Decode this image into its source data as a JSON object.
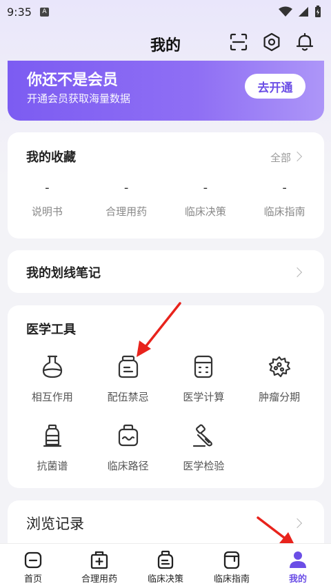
{
  "status": {
    "time": "9:35",
    "notif": "A"
  },
  "header": {
    "title": "我的"
  },
  "vip": {
    "title": "你还不是会员",
    "subtitle": "开通会员获取海量数据",
    "button": "去开通"
  },
  "favorites": {
    "title": "我的收藏",
    "all_label": "全部",
    "items": [
      {
        "label": "说明书",
        "count": "-"
      },
      {
        "label": "合理用药",
        "count": "-"
      },
      {
        "label": "临床决策",
        "count": "-"
      },
      {
        "label": "临床指南",
        "count": "-"
      }
    ]
  },
  "notes": {
    "title": "我的划线笔记"
  },
  "tools": {
    "title": "医学工具",
    "items": [
      {
        "label": "相互作用",
        "icon": "flask-icon"
      },
      {
        "label": "配伍禁忌",
        "icon": "jar-icon"
      },
      {
        "label": "医学计算",
        "icon": "calculator-icon"
      },
      {
        "label": "肿瘤分期",
        "icon": "virus-icon"
      },
      {
        "label": "抗菌谱",
        "icon": "bottle-icon"
      },
      {
        "label": "临床路径",
        "icon": "path-box-icon"
      },
      {
        "label": "医学检验",
        "icon": "test-tube-icon"
      }
    ]
  },
  "history": {
    "title": "浏览记录"
  },
  "tabbar": {
    "items": [
      {
        "label": "首页",
        "icon": "home-icon",
        "active": false
      },
      {
        "label": "合理用药",
        "icon": "medicine-icon",
        "active": false
      },
      {
        "label": "临床决策",
        "icon": "decision-icon",
        "active": false
      },
      {
        "label": "临床指南",
        "icon": "guide-icon",
        "active": false
      },
      {
        "label": "我的",
        "icon": "user-icon",
        "active": true
      }
    ]
  },
  "colors": {
    "accent": "#6b4ee6",
    "arrow": "#e8231c"
  }
}
